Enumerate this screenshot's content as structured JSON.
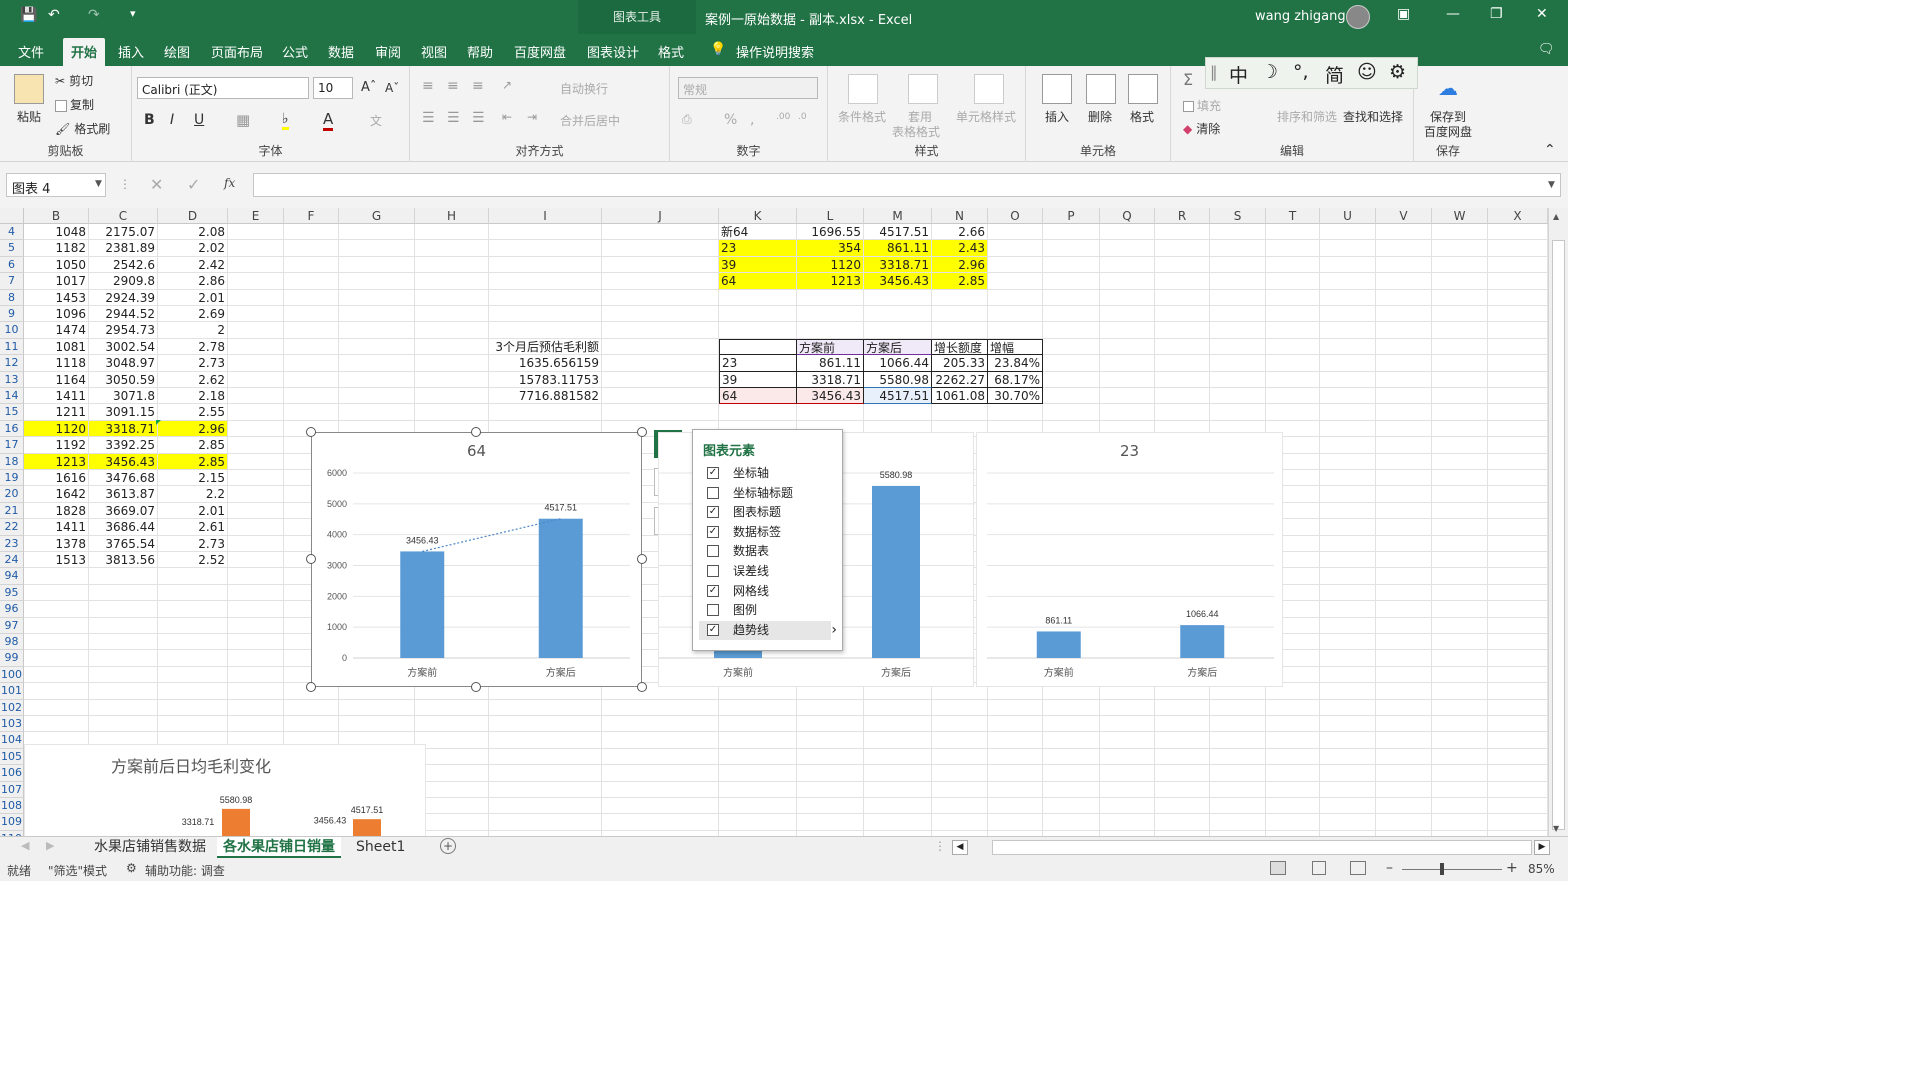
{
  "window": {
    "context_tab": "图表工具",
    "doc_title": "案例一原始数据 - 副本.xlsx  -  Excel",
    "user": "wang zhigang"
  },
  "tabs": [
    "文件",
    "开始",
    "插入",
    "绘图",
    "页面布局",
    "公式",
    "数据",
    "审阅",
    "视图",
    "帮助",
    "百度网盘",
    "图表设计",
    "格式"
  ],
  "tell_me": "操作说明搜索",
  "ribbon": {
    "clipboard": {
      "paste": "粘贴",
      "cut": "剪切",
      "copy": "复制",
      "format_painter": "格式刷",
      "label": "剪贴板"
    },
    "font": {
      "name": "Calibri (正文)",
      "size": "10",
      "label": "字体"
    },
    "align": {
      "wrap": "自动换行",
      "merge": "合并后居中",
      "label": "对齐方式"
    },
    "number": {
      "format": "常规",
      "label": "数字"
    },
    "styles": {
      "cond": "条件格式",
      "table": "套用",
      "table2": "表格格式",
      "cell": "单元格样式",
      "label": "样式"
    },
    "cells": {
      "insert": "插入",
      "delete": "删除",
      "format": "格式",
      "label": "单元格"
    },
    "edit": {
      "fill": "填充",
      "clear": "清除",
      "sort": "排序和筛选",
      "find": "查找和选择",
      "label": "编辑"
    },
    "save": {
      "btn1": "保存到",
      "btn2": "百度网盘",
      "label": "保存"
    }
  },
  "ime": [
    "中",
    "☽",
    "°,",
    "简",
    "☺",
    "⚙"
  ],
  "namebox": "图表 4",
  "fx": "fx",
  "columns": [
    "B",
    "C",
    "D",
    "E",
    "F",
    "G",
    "H",
    "I",
    "J",
    "K",
    "L",
    "M",
    "N",
    "O",
    "P",
    "Q",
    "R",
    "S",
    "T",
    "U",
    "V",
    "W",
    "X"
  ],
  "rows": [
    "4",
    "5",
    "6",
    "7",
    "8",
    "9",
    "10",
    "11",
    "12",
    "13",
    "14",
    "15",
    "16",
    "17",
    "18",
    "19",
    "20",
    "21",
    "22",
    "23",
    "24",
    "94",
    "95",
    "96",
    "97",
    "98",
    "99",
    "100",
    "101",
    "102",
    "103",
    "104",
    "105",
    "106",
    "107",
    "108",
    "109",
    "110"
  ],
  "bcd": [
    [
      "1048",
      "2175.07",
      "2.08"
    ],
    [
      "1182",
      "2381.89",
      "2.02"
    ],
    [
      "1050",
      "2542.6",
      "2.42"
    ],
    [
      "1017",
      "2909.8",
      "2.86"
    ],
    [
      "1453",
      "2924.39",
      "2.01"
    ],
    [
      "1096",
      "2944.52",
      "2.69"
    ],
    [
      "1474",
      "2954.73",
      "2"
    ],
    [
      "1081",
      "3002.54",
      "2.78"
    ],
    [
      "1118",
      "3048.97",
      "2.73"
    ],
    [
      "1164",
      "3050.59",
      "2.62"
    ],
    [
      "1411",
      "3071.8",
      "2.18"
    ],
    [
      "1211",
      "3091.15",
      "2.55"
    ],
    [
      "1120",
      "3318.71",
      "2.96"
    ],
    [
      "1192",
      "3392.25",
      "2.85"
    ],
    [
      "1213",
      "3456.43",
      "2.85"
    ],
    [
      "1616",
      "3476.68",
      "2.15"
    ],
    [
      "1642",
      "3613.87",
      "2.2"
    ],
    [
      "1828",
      "3669.07",
      "2.01"
    ],
    [
      "1411",
      "3686.44",
      "2.61"
    ],
    [
      "1378",
      "3765.54",
      "2.73"
    ],
    [
      "1513",
      "3813.56",
      "2.52"
    ]
  ],
  "klmn": [
    [
      "新64",
      "1696.55",
      "4517.51",
      "2.66"
    ],
    [
      "23",
      "354",
      "861.11",
      "2.43"
    ],
    [
      "39",
      "1120",
      "3318.71",
      "2.96"
    ],
    [
      "64",
      "1213",
      "3456.43",
      "2.85"
    ]
  ],
  "estimate": {
    "title": "3个月后预估毛利额",
    "v1": "1635.656159",
    "v2": "15783.11753",
    "v3": "7716.881582"
  },
  "compare": {
    "headers": [
      "",
      "方案前",
      "方案后",
      "增长额度",
      "增幅"
    ],
    "rows": [
      [
        "23",
        "861.11",
        "1066.44",
        "205.33",
        "23.84%"
      ],
      [
        "39",
        "3318.71",
        "5580.98",
        "2262.27",
        "68.17%"
      ],
      [
        "64",
        "3456.43",
        "4517.51",
        "1061.08",
        "30.70%"
      ]
    ]
  },
  "charts": {
    "c64": {
      "title": "64",
      "categories": [
        "方案前",
        "方案后"
      ],
      "labels": [
        "3456.43",
        "4517.51"
      ],
      "yticks": [
        "6000",
        "5000",
        "4000",
        "3000",
        "2000",
        "1000",
        "0"
      ]
    },
    "c39": {
      "categories": [
        "方案前",
        "方案后"
      ],
      "labels": [
        "5580.98"
      ]
    },
    "c23": {
      "title": "23",
      "categories": [
        "方案前",
        "方案后"
      ],
      "labels": [
        "861.11",
        "1066.44"
      ]
    },
    "bottom": {
      "title": "方案前后日均毛利变化",
      "labels": [
        "5580.98",
        "3318.71",
        "3456.43",
        "4517.51"
      ]
    }
  },
  "chart_data": [
    {
      "type": "bar",
      "title": "64",
      "categories": [
        "方案前",
        "方案后"
      ],
      "values": [
        3456.43,
        4517.51
      ],
      "ylim": [
        0,
        6000
      ],
      "trendline": true,
      "color": "#5b9bd5"
    },
    {
      "type": "bar",
      "title": "",
      "categories": [
        "方案前",
        "方案后"
      ],
      "values": [
        3318.71,
        5580.98
      ],
      "color": "#5b9bd5"
    },
    {
      "type": "bar",
      "title": "23",
      "categories": [
        "方案前",
        "方案后"
      ],
      "values": [
        861.11,
        1066.44
      ],
      "color": "#5b9bd5"
    },
    {
      "type": "bar",
      "title": "方案前后日均毛利变化",
      "values": [
        3318.71,
        5580.98,
        3456.43,
        4517.51
      ],
      "color": "#ed7d31"
    }
  ],
  "chart_elements": {
    "title": "图表元素",
    "items": [
      {
        "label": "坐标轴",
        "checked": true
      },
      {
        "label": "坐标轴标题",
        "checked": false
      },
      {
        "label": "图表标题",
        "checked": true
      },
      {
        "label": "数据标签",
        "checked": true
      },
      {
        "label": "数据表",
        "checked": false
      },
      {
        "label": "误差线",
        "checked": false
      },
      {
        "label": "网格线",
        "checked": true
      },
      {
        "label": "图例",
        "checked": false
      },
      {
        "label": "趋势线",
        "checked": true
      }
    ]
  },
  "sheets": [
    "水果店铺销售数据",
    "各水果店铺日销量",
    "Sheet1"
  ],
  "status": {
    "ready": "就绪",
    "filter": "\"筛选\"模式",
    "access": "辅助功能: 调查",
    "zoom": "85%"
  }
}
